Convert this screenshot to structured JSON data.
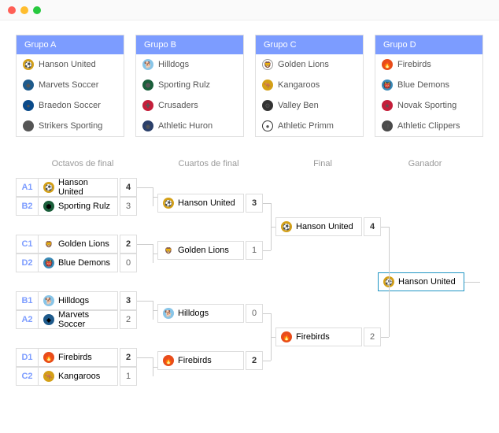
{
  "groups": [
    {
      "title": "Grupo A",
      "teams": [
        {
          "name": "Hanson United",
          "icon": "⚽",
          "bg": "#d4a017"
        },
        {
          "name": "Marvets Soccer",
          "icon": "◆",
          "bg": "#1e5a8b"
        },
        {
          "name": "Braedon Soccer",
          "icon": "●",
          "bg": "#0a4a8a"
        },
        {
          "name": "Strikers Sporting",
          "icon": "🛡",
          "bg": "#555"
        }
      ]
    },
    {
      "title": "Grupo B",
      "teams": [
        {
          "name": "Hilldogs",
          "icon": "🐕",
          "bg": "#88c5e8"
        },
        {
          "name": "Sporting Rulz",
          "icon": "⬢",
          "bg": "#1a5e3a"
        },
        {
          "name": "Crusaders",
          "icon": "✚",
          "bg": "#c41e3a"
        },
        {
          "name": "Athletic Huron",
          "icon": "◉",
          "bg": "#2a3f6a"
        }
      ]
    },
    {
      "title": "Grupo C",
      "teams": [
        {
          "name": "Golden Lions",
          "icon": "🦁",
          "bg": "#fff",
          "border": "#999"
        },
        {
          "name": "Kangaroos",
          "icon": "🦘",
          "bg": "#d4a017"
        },
        {
          "name": "Valley Ben",
          "icon": "⚙",
          "bg": "#333"
        },
        {
          "name": "Athletic Primm",
          "icon": "●",
          "bg": "#fff",
          "border": "#333"
        }
      ]
    },
    {
      "title": "Grupo D",
      "teams": [
        {
          "name": "Firebirds",
          "icon": "🔥",
          "bg": "#e84c1a"
        },
        {
          "name": "Blue Demons",
          "icon": "👹",
          "bg": "#3a8ab8"
        },
        {
          "name": "Novak Sporting",
          "icon": "★",
          "bg": "#c41e3a"
        },
        {
          "name": "Athletic Clippers",
          "icon": "🛡",
          "bg": "#4a4a4a"
        }
      ]
    }
  ],
  "rounds": {
    "r1": "Octavos de final",
    "r2": "Cuartos de final",
    "r3": "Final",
    "r4": "Ganador"
  },
  "bracket": {
    "oct": [
      {
        "seed": "A1",
        "team": "Hanson United",
        "score": "4",
        "win": true,
        "icon": "⚽",
        "bg": "#d4a017"
      },
      {
        "seed": "B2",
        "team": "Sporting Rulz",
        "score": "3",
        "win": false,
        "icon": "⬢",
        "bg": "#1a5e3a"
      },
      {
        "seed": "C1",
        "team": "Golden Lions",
        "score": "2",
        "win": true,
        "icon": "🦁",
        "bg": "#fff"
      },
      {
        "seed": "D2",
        "team": "Blue Demons",
        "score": "0",
        "win": false,
        "icon": "👹",
        "bg": "#3a8ab8"
      },
      {
        "seed": "B1",
        "team": "Hilldogs",
        "score": "3",
        "win": true,
        "icon": "🐕",
        "bg": "#88c5e8"
      },
      {
        "seed": "A2",
        "team": "Marvets Soccer",
        "score": "2",
        "win": false,
        "icon": "◆",
        "bg": "#1e5a8b"
      },
      {
        "seed": "D1",
        "team": "Firebirds",
        "score": "2",
        "win": true,
        "icon": "🔥",
        "bg": "#e84c1a"
      },
      {
        "seed": "C2",
        "team": "Kangaroos",
        "score": "1",
        "win": false,
        "icon": "🦘",
        "bg": "#d4a017"
      }
    ],
    "qf": [
      {
        "team": "Hanson United",
        "score": "3",
        "win": true,
        "icon": "⚽",
        "bg": "#d4a017"
      },
      {
        "team": "Golden Lions",
        "score": "1",
        "win": false,
        "icon": "🦁",
        "bg": "#fff"
      },
      {
        "team": "Hilldogs",
        "score": "0",
        "win": false,
        "icon": "🐕",
        "bg": "#88c5e8"
      },
      {
        "team": "Firebirds",
        "score": "2",
        "win": true,
        "icon": "🔥",
        "bg": "#e84c1a"
      }
    ],
    "final": [
      {
        "team": "Hanson United",
        "score": "4",
        "win": true,
        "icon": "⚽",
        "bg": "#d4a017"
      },
      {
        "team": "Firebirds",
        "score": "2",
        "win": false,
        "icon": "🔥",
        "bg": "#e84c1a"
      }
    ],
    "winner": {
      "team": "Hanson United",
      "icon": "⚽",
      "bg": "#d4a017"
    }
  }
}
